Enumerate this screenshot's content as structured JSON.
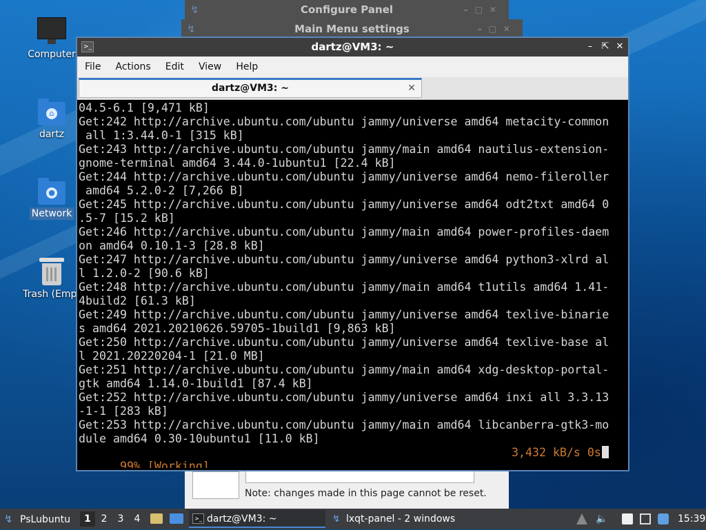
{
  "desktop": {
    "icons": [
      {
        "label": "Computer"
      },
      {
        "label": "dartz"
      },
      {
        "label": "Network"
      },
      {
        "label": "Trash (Empt"
      }
    ]
  },
  "background_windows": {
    "configure_panel_title": "Configure Panel",
    "main_menu_settings_title": "Main Menu settings",
    "configure_panel_note": "Note: changes made in this page cannot be reset."
  },
  "terminal": {
    "window_title": "dartz@VM3: ~",
    "menu": [
      "File",
      "Actions",
      "Edit",
      "View",
      "Help"
    ],
    "tab_title": "dartz@VM3: ~",
    "lines": [
      "04.5-6.1 [9,471 kB]",
      "Get:242 http://archive.ubuntu.com/ubuntu jammy/universe amd64 metacity-common",
      " all 1:3.44.0-1 [315 kB]",
      "Get:243 http://archive.ubuntu.com/ubuntu jammy/main amd64 nautilus-extension-",
      "gnome-terminal amd64 3.44.0-1ubuntu1 [22.4 kB]",
      "Get:244 http://archive.ubuntu.com/ubuntu jammy/universe amd64 nemo-fileroller",
      " amd64 5.2.0-2 [7,266 B]",
      "Get:245 http://archive.ubuntu.com/ubuntu jammy/universe amd64 odt2txt amd64 0",
      ".5-7 [15.2 kB]",
      "Get:246 http://archive.ubuntu.com/ubuntu jammy/main amd64 power-profiles-daem",
      "on amd64 0.10.1-3 [28.8 kB]",
      "Get:247 http://archive.ubuntu.com/ubuntu jammy/universe amd64 python3-xlrd al",
      "l 1.2.0-2 [90.6 kB]",
      "Get:248 http://archive.ubuntu.com/ubuntu jammy/main amd64 t1utils amd64 1.41-",
      "4build2 [61.3 kB]",
      "Get:249 http://archive.ubuntu.com/ubuntu jammy/universe amd64 texlive-binarie",
      "s amd64 2021.20210626.59705-1build1 [9,863 kB]",
      "Get:250 http://archive.ubuntu.com/ubuntu jammy/universe amd64 texlive-base al",
      "l 2021.20220204-1 [21.0 MB]",
      "Get:251 http://archive.ubuntu.com/ubuntu jammy/main amd64 xdg-desktop-portal-",
      "gtk amd64 1.14.0-1build1 [87.4 kB]",
      "Get:252 http://archive.ubuntu.com/ubuntu jammy/universe amd64 inxi all 3.3.13",
      "-1-1 [283 kB]",
      "Get:253 http://archive.ubuntu.com/ubuntu jammy/main amd64 libcanberra-gtk3-mo",
      "dule amd64 0.30-10ubuntu1 [11.0 kB]"
    ],
    "status_left": "99% [Working]",
    "status_right": "3,432 kB/s 0s"
  },
  "taskbar": {
    "start_label": "PsLubuntu",
    "workspaces": [
      "1",
      "2",
      "3",
      "4"
    ],
    "active_workspace": "1",
    "tasks": [
      {
        "label": "dartz@VM3: ~",
        "active": true
      },
      {
        "label": "lxqt-panel - 2 windows",
        "active": false
      }
    ],
    "clock": "15:39"
  },
  "colors": {
    "terminal_text": "#d6d6d6",
    "status_text": "#d07a30",
    "window_border": "#5a86b8",
    "taskbar_bg": "#3b3d40"
  }
}
